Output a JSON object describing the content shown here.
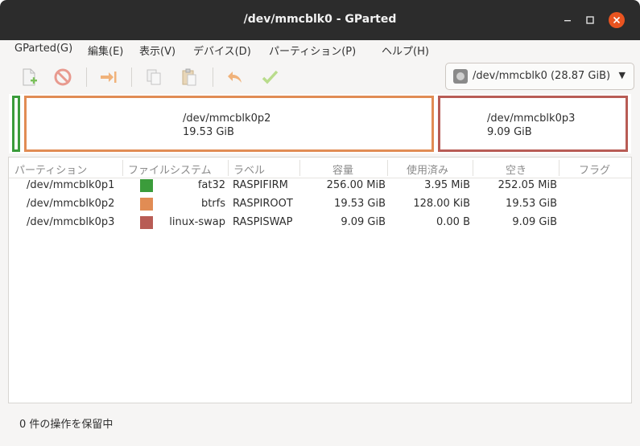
{
  "window": {
    "title": "/dev/mmcblk0 - GParted"
  },
  "menu": [
    "GParted(G)",
    "編集(E)",
    "表示(V)",
    "デバイス(D)",
    "パーティション(P)",
    "ヘルプ(H)"
  ],
  "toolbar": {
    "icons": [
      "new-partition-icon",
      "delete-icon",
      "resize-move-icon",
      "copy-icon",
      "paste-icon",
      "undo-icon",
      "apply-icon"
    ]
  },
  "device_selector": {
    "label": "/dev/mmcblk0 (28.87 GiB)"
  },
  "map": {
    "p2": {
      "name": "/dev/mmcblk0p2",
      "size": "19.53 GiB",
      "color": "#e18c54"
    },
    "p3": {
      "name": "/dev/mmcblk0p3",
      "size": "9.09 GiB",
      "color": "#b85c55"
    },
    "p1": {
      "color": "#3b9c3b"
    }
  },
  "table": {
    "headers": [
      "パーティション",
      "ファイルシステム",
      "ラベル",
      "容量",
      "使用済み",
      "空き",
      "フラグ"
    ],
    "rows": [
      {
        "partition": "/dev/mmcblk0p1",
        "color": "#3b9c3b",
        "fs": "fat32",
        "label": "RASPIFIRM",
        "size": "256.00 MiB",
        "used": "3.95 MiB",
        "free": "252.05 MiB",
        "flags": ""
      },
      {
        "partition": "/dev/mmcblk0p2",
        "color": "#e18c54",
        "fs": "btrfs",
        "label": "RASPIROOT",
        "size": "19.53 GiB",
        "used": "128.00 KiB",
        "free": "19.53 GiB",
        "flags": ""
      },
      {
        "partition": "/dev/mmcblk0p3",
        "color": "#b85c55",
        "fs": "linux-swap",
        "label": "RASPISWAP",
        "size": "9.09 GiB",
        "used": "0.00 B",
        "free": "9.09 GiB",
        "flags": ""
      }
    ]
  },
  "status": {
    "text": "0 件の操作を保留中"
  }
}
